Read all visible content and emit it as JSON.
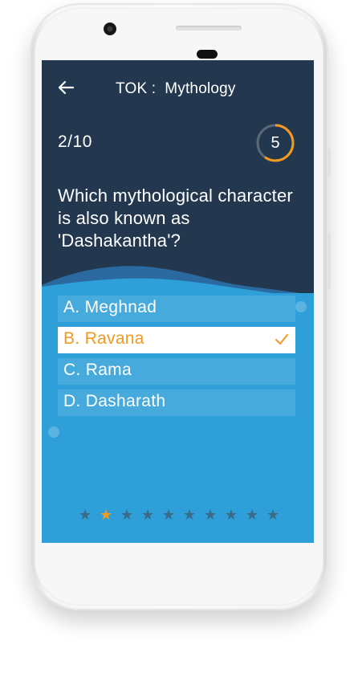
{
  "header": {
    "title": "TOK :  Mythology"
  },
  "quiz": {
    "counter": "2/10",
    "timer": "5",
    "timer_fraction": 0.6
  },
  "question": {
    "text": "Which mythological character is also known as 'Dashakantha'?"
  },
  "options": [
    {
      "label": "A. Meghnad",
      "selected": false
    },
    {
      "label": "B. Ravana",
      "selected": true
    },
    {
      "label": "C. Rama",
      "selected": false
    },
    {
      "label": "D. Dasharath",
      "selected": false
    }
  ],
  "progress": {
    "total_stars": 10,
    "filled_index": 1
  },
  "colors": {
    "background": "#23384f",
    "answers_background": "#2e9fd8",
    "accent": "#f39a1f",
    "star_inactive": "#3a6b87"
  },
  "icons": {
    "back": "arrow-left-icon",
    "check": "checkmark-icon",
    "star": "star-icon"
  }
}
